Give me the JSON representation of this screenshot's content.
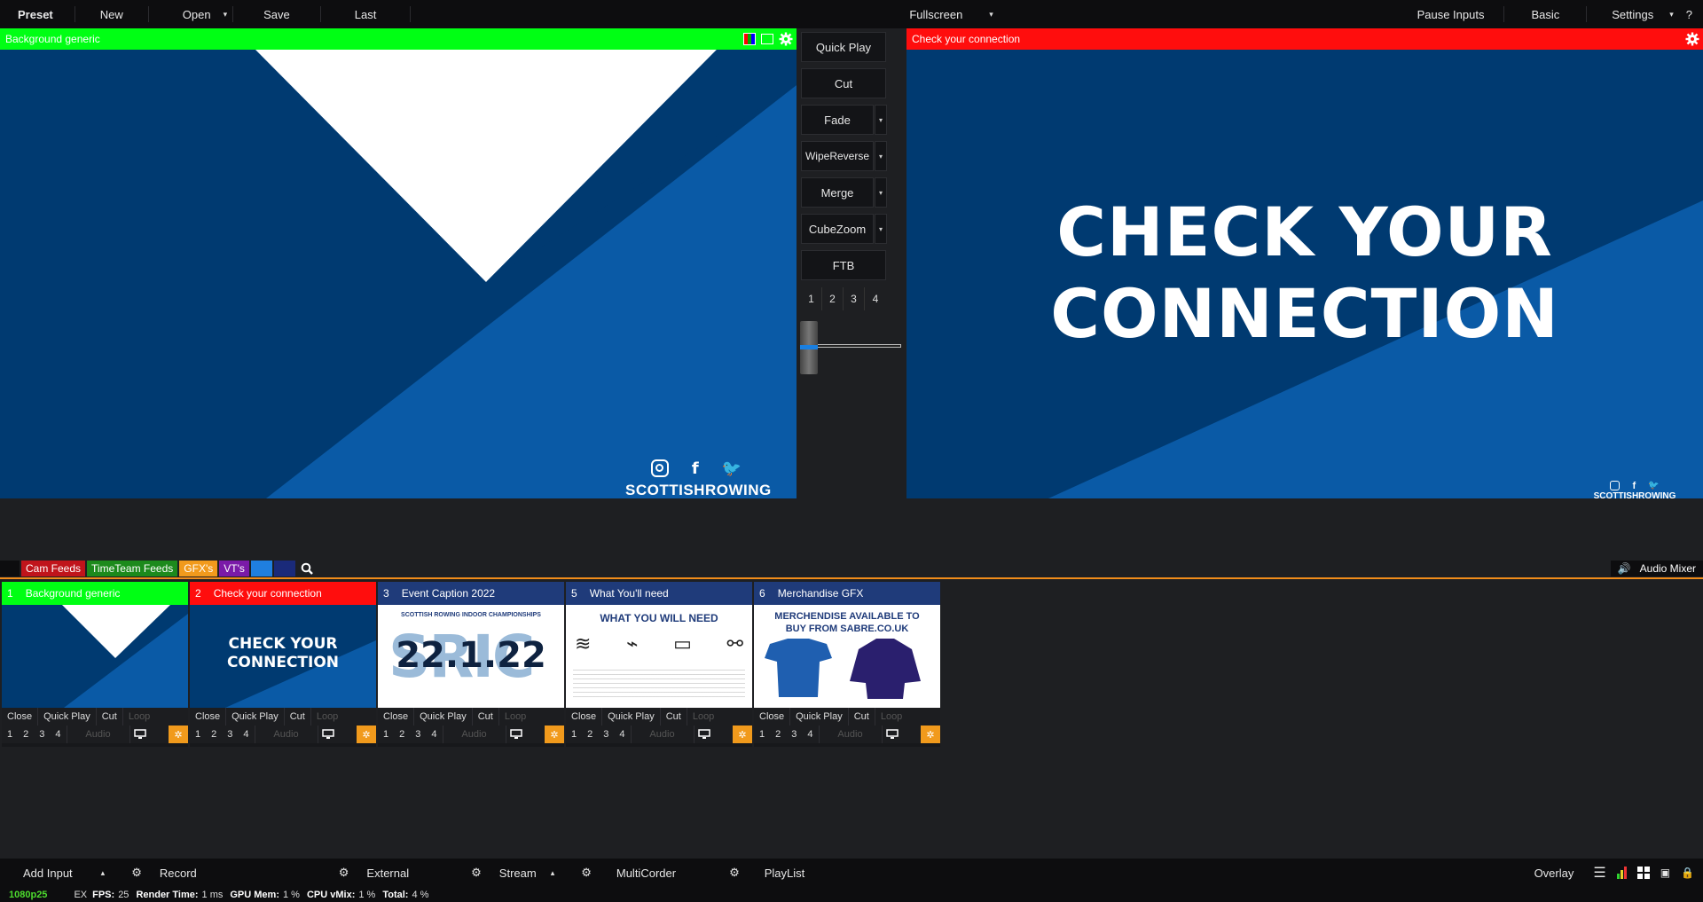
{
  "colors": {
    "green": "#00ff14",
    "red": "#ff0d0d",
    "blue": "#003a71",
    "orange": "#f19a1c",
    "navy": "#1f3b7a"
  },
  "topbar": {
    "preset": "Preset",
    "new": "New",
    "open": "Open",
    "save": "Save",
    "last": "Last",
    "fullscreen": "Fullscreen",
    "pause_inputs": "Pause Inputs",
    "basic": "Basic",
    "settings": "Settings",
    "help": "?"
  },
  "preview": {
    "title": "Background generic",
    "brand": "SCOTTISHROWING"
  },
  "output": {
    "title": "Check your connection",
    "line1": "CHECK YOUR",
    "line2": "CONNECTION",
    "brand": "SCOTTISHROWING"
  },
  "transitions": {
    "quick_play": "Quick Play",
    "cut": "Cut",
    "fade": "Fade",
    "wipe": "WipeReverse",
    "merge": "Merge",
    "cubezoom": "CubeZoom",
    "ftb": "FTB",
    "numbers": [
      "1",
      "2",
      "3",
      "4"
    ]
  },
  "tabs": {
    "items": [
      {
        "label": "Cam Feeds",
        "color": "#c0141b"
      },
      {
        "label": "TimeTeam Feeds",
        "color": "#1c8a1c"
      },
      {
        "label": "GFX's",
        "color": "#f19a1c"
      },
      {
        "label": "VT's",
        "color": "#7a1aa8"
      }
    ],
    "audio_mixer": "Audio Mixer"
  },
  "tiles": [
    {
      "num": "1",
      "title": "Background generic",
      "head_color": "#00ff14",
      "head_text": "#ffffff"
    },
    {
      "num": "2",
      "title": "Check your connection",
      "head_color": "#ff0d0d",
      "head_text": "#ffffff",
      "thumb_line1": "CHECK YOUR",
      "thumb_line2": "CONNECTION"
    },
    {
      "num": "3",
      "title": "Event Caption 2022",
      "head_color": "#1f3b7a",
      "head_text": "#ffffff",
      "thumb_top": "SCOTTISH ROWING INDOOR CHAMPIONSHIPS",
      "thumb_date": "22.1.22"
    },
    {
      "num": "5",
      "title": "What You'll need",
      "head_color": "#1f3b7a",
      "head_text": "#ffffff",
      "thumb_top": "WHAT YOU WILL NEED"
    },
    {
      "num": "6",
      "title": "Merchandise GFX",
      "head_color": "#1f3b7a",
      "head_text": "#ffffff",
      "thumb_line1": "MERCHENDISE AVAILABLE TO",
      "thumb_line2": "BUY FROM SABRE.CO.UK"
    }
  ],
  "tile_controls": {
    "close": "Close",
    "quick_play": "Quick Play",
    "cut": "Cut",
    "loop": "Loop",
    "audio": "Audio",
    "numbers": [
      "1",
      "2",
      "3",
      "4"
    ]
  },
  "bottombar": {
    "add_input": "Add Input",
    "record": "Record",
    "external": "External",
    "stream": "Stream",
    "multicorder": "MultiCorder",
    "playlist": "PlayList",
    "overlay": "Overlay"
  },
  "status": {
    "format": "1080p25",
    "ex": "EX",
    "fps_label": "FPS:",
    "fps": "25",
    "render_label": "Render Time:",
    "render": "1 ms",
    "gpu_label": "GPU Mem:",
    "gpu": "1 %",
    "cpu_label": "CPU vMix:",
    "cpu": "1 %",
    "total_label": "Total:",
    "total": "4 %"
  }
}
